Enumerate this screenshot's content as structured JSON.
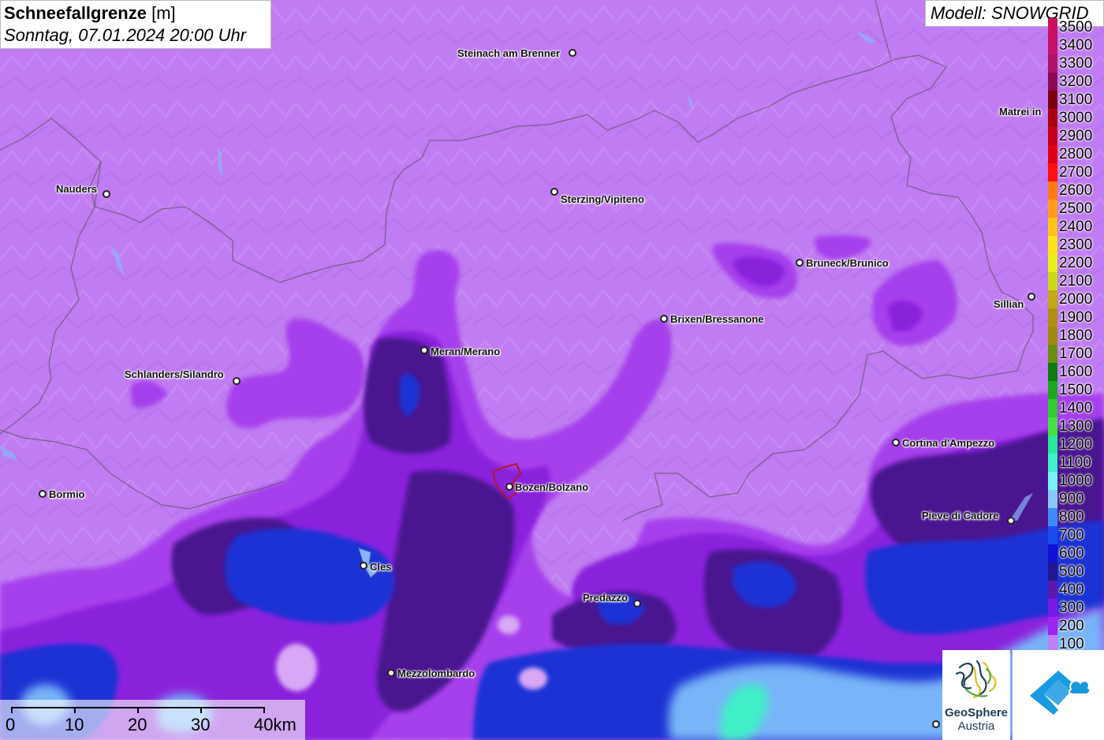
{
  "title": {
    "main": "Schneefallgrenze",
    "unit": "[m]",
    "datetime": "Sonntag, 07.01.2024 20:00 Uhr"
  },
  "model": "Modell: SNOWGRID",
  "legend": [
    {
      "label": "3500",
      "color": "#cc1060"
    },
    {
      "label": "3400",
      "color": "#c51269"
    },
    {
      "label": "3300",
      "color": "#b0126a"
    },
    {
      "label": "3200",
      "color": "#8c0b50"
    },
    {
      "label": "3100",
      "color": "#7a0010"
    },
    {
      "label": "3000",
      "color": "#a80010"
    },
    {
      "label": "2900",
      "color": "#c4001a"
    },
    {
      "label": "2800",
      "color": "#e00014"
    },
    {
      "label": "2700",
      "color": "#ff1010"
    },
    {
      "label": "2600",
      "color": "#ff7a18"
    },
    {
      "label": "2500",
      "color": "#ff9c1a"
    },
    {
      "label": "2400",
      "color": "#ffc21a"
    },
    {
      "label": "2300",
      "color": "#ffe21a"
    },
    {
      "label": "2200",
      "color": "#e6f018"
    },
    {
      "label": "2100",
      "color": "#c8d818"
    },
    {
      "label": "2000",
      "color": "#c0a818"
    },
    {
      "label": "1900",
      "color": "#b08e14"
    },
    {
      "label": "1800",
      "color": "#a08a12"
    },
    {
      "label": "1700",
      "color": "#6a8e10"
    },
    {
      "label": "1600",
      "color": "#0e7a10"
    },
    {
      "label": "1500",
      "color": "#1ea81e"
    },
    {
      "label": "1400",
      "color": "#30cc30"
    },
    {
      "label": "1300",
      "color": "#44e044"
    },
    {
      "label": "1200",
      "color": "#28e89a"
    },
    {
      "label": "1100",
      "color": "#40f0c8"
    },
    {
      "label": "1000",
      "color": "#7af0f4"
    },
    {
      "label": "900",
      "color": "#88c8f8"
    },
    {
      "label": "800",
      "color": "#3c8cf8"
    },
    {
      "label": "700",
      "color": "#1a4cf0"
    },
    {
      "label": "600",
      "color": "#1010d8"
    },
    {
      "label": "500",
      "color": "#24168c"
    },
    {
      "label": "400",
      "color": "#5a18b0"
    },
    {
      "label": "300",
      "color": "#7a18e8"
    },
    {
      "label": "200",
      "color": "#9e26ec"
    },
    {
      "label": "100",
      "color": "#c080f4"
    }
  ],
  "cities": [
    {
      "name": "Steinach am Brenner"
    },
    {
      "name": "Matrei in"
    },
    {
      "name": "Nauders"
    },
    {
      "name": "Sterzing/Vipiteno"
    },
    {
      "name": "Bruneck/Brunico"
    },
    {
      "name": "Sillian"
    },
    {
      "name": "Brixen/Bressanone"
    },
    {
      "name": "Meran/Merano"
    },
    {
      "name": "Schlanders/Silandro"
    },
    {
      "name": "Cortina d'Ampezzo"
    },
    {
      "name": "Bormio"
    },
    {
      "name": "Bozen/Bolzano"
    },
    {
      "name": "Pieve di Cadore"
    },
    {
      "name": "Cles"
    },
    {
      "name": "Predazzo"
    },
    {
      "name": "Mezzolombardo"
    },
    {
      "name": ""
    }
  ],
  "scale": {
    "labels": [
      "0",
      "10",
      "20",
      "30",
      "40km"
    ]
  },
  "logo": {
    "name": "GeoSphere",
    "sub": "Austria"
  }
}
